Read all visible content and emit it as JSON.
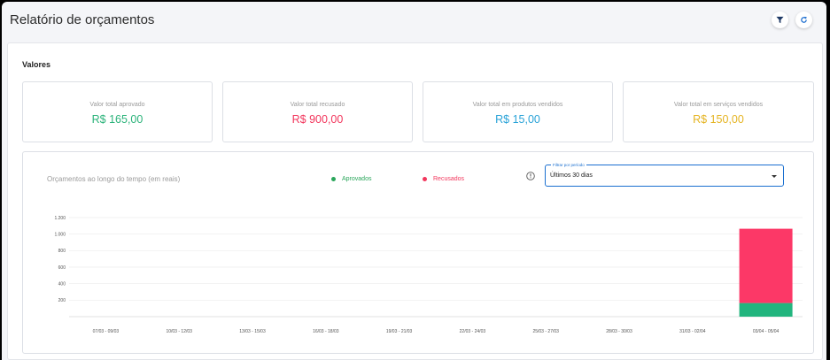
{
  "header": {
    "title": "Relatório de orçamentos",
    "filter_icon": "filter-icon",
    "refresh_icon": "refresh-icon"
  },
  "section": {
    "title": "Valores"
  },
  "cards": [
    {
      "label": "Valor total aprovado",
      "value": "R$ 165,00",
      "color": "#2bb37a"
    },
    {
      "label": "Valor total recusado",
      "value": "R$ 900,00",
      "color": "#f2365c"
    },
    {
      "label": "Valor total em produtos vendidos",
      "value": "R$ 15,00",
      "color": "#2aa3d8"
    },
    {
      "label": "Valor total em serviços vendidos",
      "value": "R$ 150,00",
      "color": "#e5b422"
    }
  ],
  "chart": {
    "title": "Orçamentos ao longo do tempo (em reais)",
    "legend": [
      {
        "label": "Aprovados",
        "color": "#2aa65b"
      },
      {
        "label": "Recusados",
        "color": "#f2365c"
      }
    ],
    "period_filter": {
      "label": "Filtrar por período",
      "value": "Últimos 30 dias"
    },
    "info_icon": "info-icon"
  },
  "chart_data": {
    "type": "bar",
    "stacked": true,
    "categories": [
      "07/03 - 09/03",
      "10/03 - 12/03",
      "13/03 - 15/03",
      "16/03 - 18/03",
      "19/03 - 21/03",
      "22/03 - 24/03",
      "25/03 - 27/03",
      "28/03 - 30/03",
      "31/03 - 02/04",
      "03/04 - 05/04"
    ],
    "series": [
      {
        "name": "Aprovados",
        "color": "#22b57e",
        "values": [
          0,
          0,
          0,
          0,
          0,
          0,
          0,
          0,
          0,
          165
        ]
      },
      {
        "name": "Recusados",
        "color": "#fc3867",
        "values": [
          0,
          0,
          0,
          0,
          0,
          0,
          0,
          0,
          0,
          900
        ]
      }
    ],
    "yticks": [
      "1.200",
      "1.000",
      "800",
      "600",
      "400",
      "200"
    ],
    "ytick_values": [
      1200,
      1000,
      800,
      600,
      400,
      200
    ],
    "ylim": [
      0,
      1200
    ],
    "grid": true,
    "legend_position": "top"
  }
}
